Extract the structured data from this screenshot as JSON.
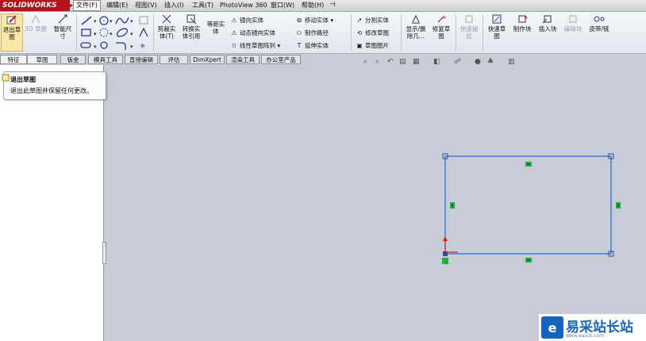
{
  "app": {
    "brand": "SOLIDWORKS"
  },
  "menu": {
    "items": [
      {
        "label": "文件(F)"
      },
      {
        "label": "编辑(E)"
      },
      {
        "label": "视图(V)"
      },
      {
        "label": "插入(I)"
      },
      {
        "label": "工具(T)"
      },
      {
        "label": "PhotoView 360"
      },
      {
        "label": "窗口(W)"
      },
      {
        "label": "帮助(H)"
      }
    ]
  },
  "ribbon": {
    "exit_sketch": "退出草图",
    "sketch_3d": "3D 草图",
    "smart_dim": "智能尺寸",
    "trim": "剪裁实体(T)",
    "convert": "转换实体引用",
    "offset": "等距实体",
    "mirror": "镜向实体",
    "dyn_mirror": "动态镜向实体",
    "linear_pattern": "线性草图阵列",
    "move": "移动实体",
    "make_path": "制作路径",
    "extend": "延伸实体",
    "split": "分割实体",
    "modify": "修改草图",
    "sketch_picture": "草图图片",
    "show_delete": "显示/删除几...",
    "repair": "修复草图",
    "quick_snap": "快速捕捉",
    "quick_sketch": "快速草图",
    "make_block": "制作块",
    "insert_block": "插入块",
    "edit_block": "编辑块",
    "belt": "皮带/链"
  },
  "tabs": [
    {
      "label": "特征"
    },
    {
      "label": "草图"
    },
    {
      "label": "钣金"
    },
    {
      "label": "模具工具"
    },
    {
      "label": "直接编辑"
    },
    {
      "label": "评估"
    },
    {
      "label": "DimXpert"
    },
    {
      "label": "渲染工具"
    },
    {
      "label": "办公室产品"
    }
  ],
  "tooltip": {
    "title": "退出草图",
    "desc": "退出此草图并保留任何更改。"
  },
  "watermark": {
    "text": "易采站长站",
    "sub": "www.easck.com"
  },
  "colors": {
    "brand_red": "#b5121b",
    "sketch_line": "#2a6fd6",
    "relation_green": "#1fb23a",
    "origin_red": "#d0201a"
  },
  "icons": [
    "exit-sketch-icon",
    "line-icon",
    "circle-icon",
    "spline-icon",
    "rectangle-icon",
    "trim-icon",
    "mirror-icon",
    "move-icon",
    "split-icon",
    "repair-icon",
    "block-icon",
    "belt-icon"
  ]
}
